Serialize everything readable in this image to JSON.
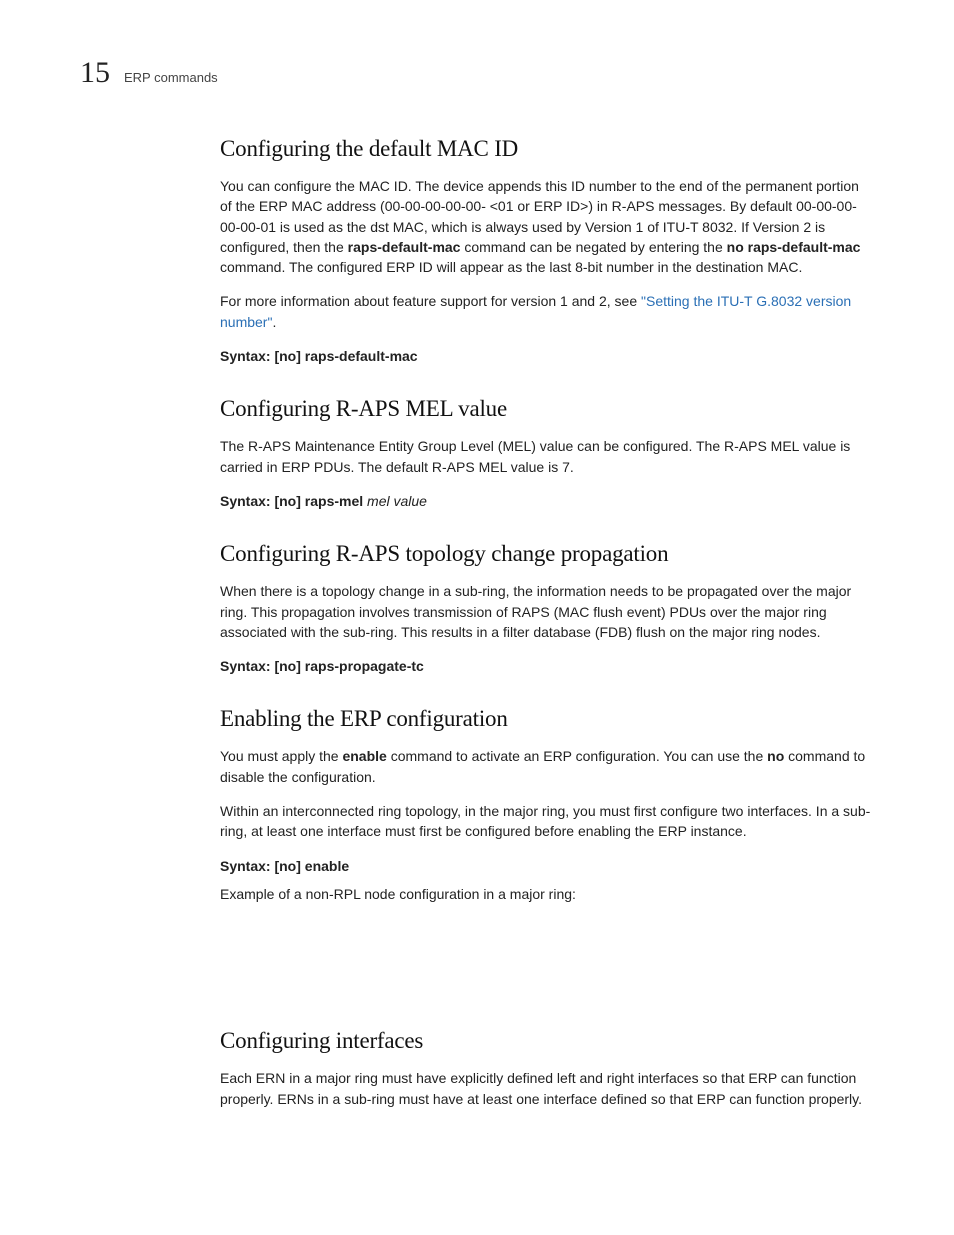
{
  "header": {
    "chapter_number": "15",
    "chapter_title": "ERP commands"
  },
  "sections": {
    "mac_id": {
      "heading": "Configuring the default MAC ID",
      "p1_a": "You can configure the MAC ID. The device appends this ID number to the end of the permanent portion of the ERP MAC address (00-00-00-00-00- <01 or ERP ID>) in R-APS messages. By default 00-00-00-00-00-01 is used as the dst MAC, which is always used by Version 1 of ITU-T 8032. If Version 2 is configured, then the ",
      "p1_bold1": "raps-default-mac",
      "p1_b": " command can be negated by entering the ",
      "p1_bold2": "no raps-default-mac",
      "p1_c": " command. The configured ERP ID will appear as the last 8-bit number in the destination MAC.",
      "p2_a": "For more information about feature support for version 1 and 2, see ",
      "p2_link": "\"Setting the ITU-T G.8032 version number\"",
      "p2_b": ".",
      "syntax_label": "Syntax:",
      "syntax_cmd": " [no] raps-default-mac"
    },
    "mel": {
      "heading": "Configuring R-APS MEL value",
      "p1": "The R-APS Maintenance Entity Group Level (MEL) value can be configured. The R-APS MEL value is carried in ERP PDUs. The default R-APS MEL value is 7.",
      "syntax_label": "Syntax:",
      "syntax_cmd": " [no] raps-mel ",
      "syntax_arg": "mel value"
    },
    "topo": {
      "heading": "Configuring R-APS topology change propagation",
      "p1": "When there is a topology change in a sub-ring, the information needs to be propagated over the major ring. This propagation involves transmission of RAPS (MAC flush event) PDUs over the major ring associated with the sub-ring. This results in a filter database (FDB) flush on the major ring nodes.",
      "syntax_label": "Syntax:",
      "syntax_cmd": " [no] raps-propagate-tc"
    },
    "enable": {
      "heading": "Enabling the ERP configuration",
      "p1_a": "You must apply the ",
      "p1_bold1": "enable",
      "p1_b": " command to activate an ERP configuration. You can use the ",
      "p1_bold2": "no",
      "p1_c": " command to disable the configuration.",
      "p2": "Within an interconnected ring topology, in the major ring, you must first configure two interfaces. In a sub-ring, at least one interface must first be configured before enabling the ERP instance.",
      "syntax_label": "Syntax:",
      "syntax_cmd": " [no] enable",
      "p3": "Example of a non-RPL node configuration in a major ring:"
    },
    "interfaces": {
      "heading": "Configuring interfaces",
      "p1": "Each ERN in a major ring must have explicitly defined left and right interfaces so that ERP can function properly. ERNs in a sub-ring must have at least one interface defined so that ERP can function properly."
    }
  }
}
